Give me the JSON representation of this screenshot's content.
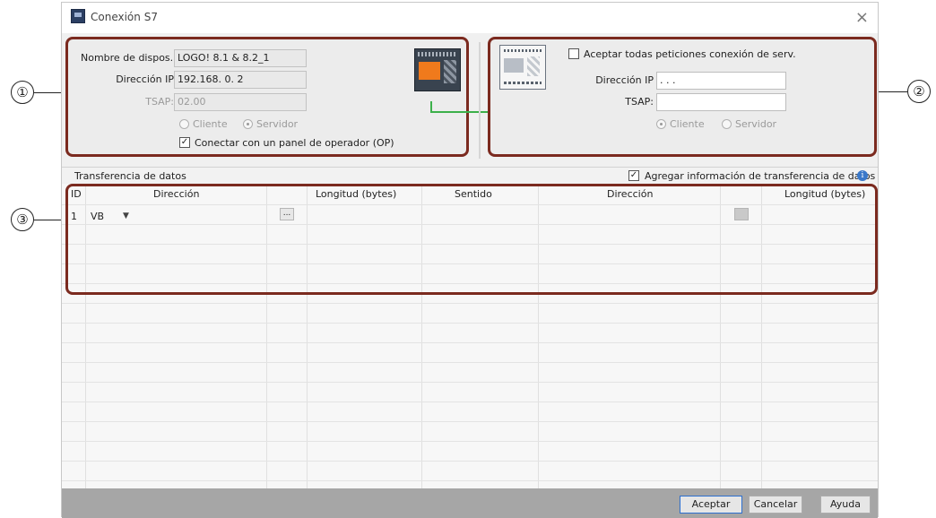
{
  "window": {
    "title": "Conexión S7",
    "close_glyph": "×"
  },
  "local": {
    "device_name_label": "Nombre de dispos...",
    "device_name_value": "LOGO! 8.1 & 8.2_1",
    "ip_label": "Dirección IP",
    "ip_value": "192.168.  0.  2",
    "tsap_label": "TSAP:",
    "tsap_value": "02.00",
    "client_label": "Cliente",
    "server_label": "Servidor",
    "op_panel_label": "Conectar con un panel de operador (OP)"
  },
  "remote": {
    "accept_all_label": "Aceptar todas peticiones conexión de serv.",
    "ip_label": "Dirección IP",
    "ip_value": " .   .   .",
    "tsap_label": "TSAP:",
    "tsap_value": "",
    "client_label": "Cliente",
    "server_label": "Servidor"
  },
  "transfer": {
    "title": "Transferencia de datos",
    "add_info_label": "Agregar información de transferencia de datos",
    "info_glyph": "i",
    "columns": [
      "ID",
      "Dirección",
      "Longitud (bytes)",
      "Sentido",
      "Dirección",
      "Longitud (bytes)"
    ],
    "rows": [
      {
        "id": "1",
        "area": "VB",
        "dropdown_glyph": "▼",
        "browse_glyph": "..."
      }
    ]
  },
  "buttons": {
    "ok": "Aceptar",
    "cancel": "Cancelar",
    "help": "Ayuda"
  },
  "callouts": [
    "①",
    "②",
    "③"
  ],
  "colors": {
    "callout_frame": "#7b2a1f",
    "connection_line": "#3cb04a",
    "plc_display": "#f07a1c",
    "footer": "#a6a6a6"
  }
}
